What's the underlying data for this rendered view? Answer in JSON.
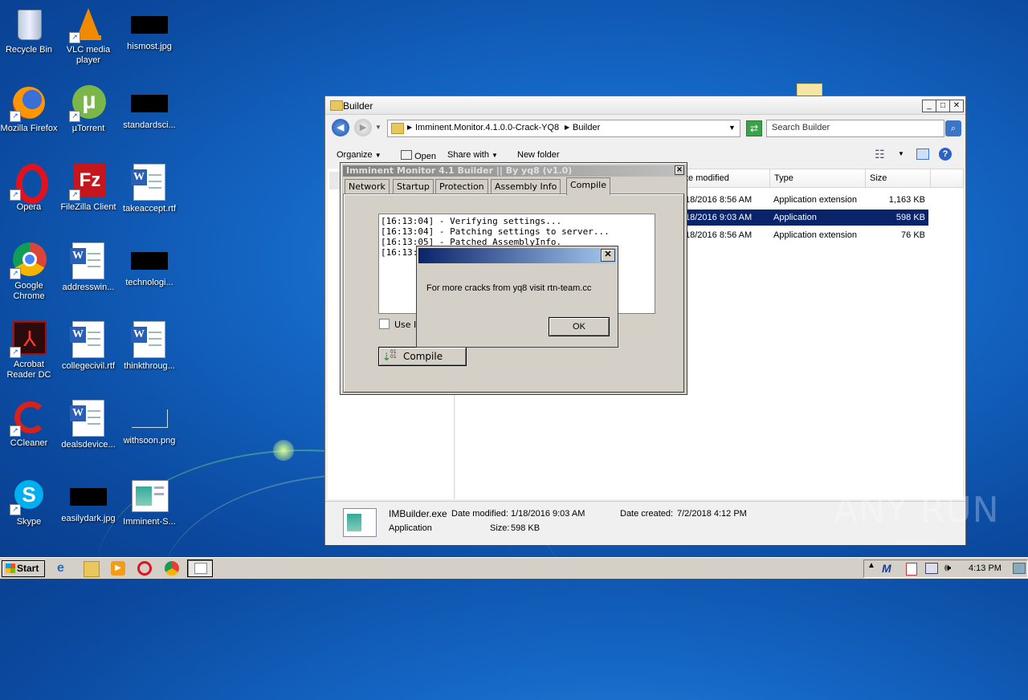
{
  "desktop": {
    "icons": [
      {
        "label": "Recycle Bin"
      },
      {
        "label": "VLC media player"
      },
      {
        "label": "hismost.jpg"
      },
      {
        "label": "Mozilla Firefox"
      },
      {
        "label": "µTorrent"
      },
      {
        "label": "standardsci..."
      },
      {
        "label": "Opera"
      },
      {
        "label": "FileZilla Client"
      },
      {
        "label": "takeaccept.rtf"
      },
      {
        "label": "Google Chrome"
      },
      {
        "label": "addresswin..."
      },
      {
        "label": "technologi..."
      },
      {
        "label": "Acrobat Reader DC"
      },
      {
        "label": "collegecivil.rtf"
      },
      {
        "label": "thinkthroug..."
      },
      {
        "label": "CCleaner"
      },
      {
        "label": "dealsdevice..."
      },
      {
        "label": "withsoon.png"
      },
      {
        "label": "Skype"
      },
      {
        "label": "easilydark.jpg"
      },
      {
        "label": "Imminent-S..."
      }
    ]
  },
  "explorer": {
    "title": "Builder",
    "breadcrumb": [
      "Imminent.Monitor.4.1.0.0-Crack-YQ8",
      "Builder"
    ],
    "search_placeholder": "Search Builder",
    "commands": {
      "organize": "Organize",
      "open": "Open",
      "share_with": "Share with",
      "new_folder": "New folder"
    },
    "columns": {
      "date": "te modified",
      "type": "Type",
      "size": "Size"
    },
    "files": [
      {
        "date": "18/2016 8:56 AM",
        "type": "Application extension",
        "size": "1,163 KB",
        "selected": false
      },
      {
        "date": "18/2016 9:03 AM",
        "type": "Application",
        "size": "598 KB",
        "selected": true
      },
      {
        "date": "18/2016 8:56 AM",
        "type": "Application extension",
        "size": "76 KB",
        "selected": false
      }
    ],
    "details": {
      "name": "IMBuilder.exe",
      "modified_label": "Date modified:",
      "modified": "1/18/2016 9:03 AM",
      "created_label": "Date created:",
      "created": "7/2/2018 4:12 PM",
      "kind": "Application",
      "size_label": "Size:",
      "size": "598 KB"
    }
  },
  "builder": {
    "title": "Imminent Monitor 4.1 Builder || By yq8 (v1.0)",
    "tabs": [
      "Network",
      "Startup",
      "Protection",
      "Assembly Info",
      "Compile"
    ],
    "active_tab": "Compile",
    "log": [
      "[16:13:04] - Verifying settings...",
      "[16:13:04] - Patching settings to server...",
      "[16:13:05] - Patched AssemblyInfo.",
      "[16:13:"
    ],
    "checkbox_label": "Use I",
    "compile_button": "Compile"
  },
  "messagebox": {
    "text": "For more cracks from yq8 visit rtn-team.cc",
    "ok": "OK"
  },
  "taskbar": {
    "start": "Start",
    "clock": "4:13 PM"
  },
  "watermark": "ANY RUN"
}
